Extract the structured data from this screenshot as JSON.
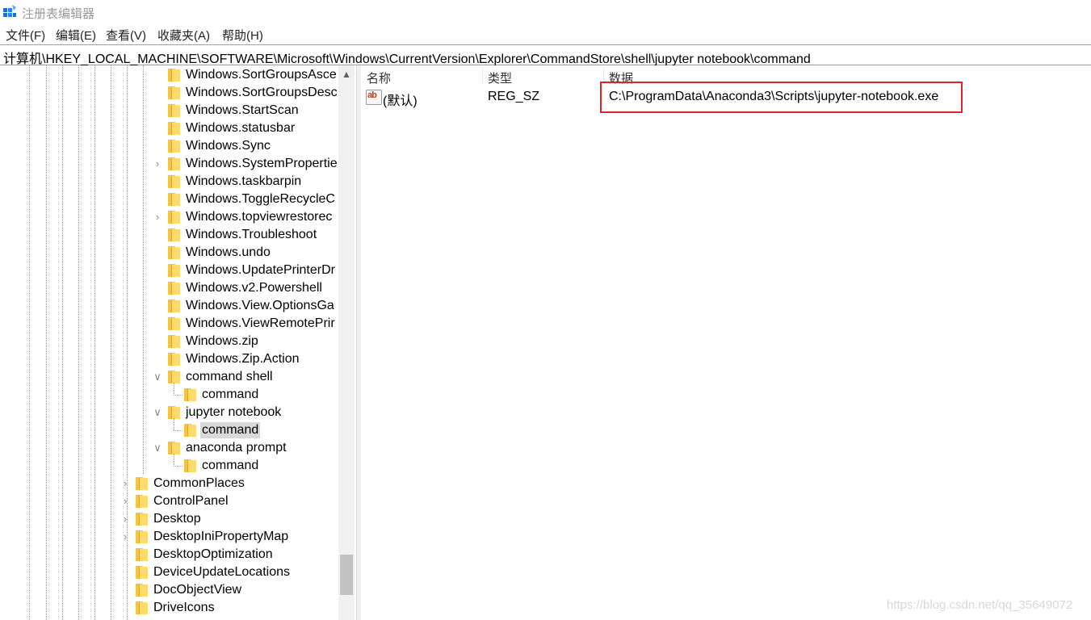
{
  "window": {
    "title": "注册表编辑器"
  },
  "menu": [
    {
      "label": "文件(F)"
    },
    {
      "label": "编辑(E)"
    },
    {
      "label": "查看(V)"
    },
    {
      "label": "收藏夹(A)"
    },
    {
      "label": "帮助(H)"
    }
  ],
  "address": "计算机\\HKEY_LOCAL_MACHINE\\SOFTWARE\\Microsoft\\Windows\\CurrentVersion\\Explorer\\CommandStore\\shell\\jupyter notebook\\command",
  "tree": {
    "items": [
      {
        "label": "Windows.SortGroupsAsce",
        "level": 2,
        "expander": "none",
        "selected": false
      },
      {
        "label": "Windows.SortGroupsDesc",
        "level": 2,
        "expander": "none",
        "selected": false
      },
      {
        "label": "Windows.StartScan",
        "level": 2,
        "expander": "none",
        "selected": false
      },
      {
        "label": "Windows.statusbar",
        "level": 2,
        "expander": "none",
        "selected": false
      },
      {
        "label": "Windows.Sync",
        "level": 2,
        "expander": "none",
        "selected": false
      },
      {
        "label": "Windows.SystemPropertie",
        "level": 2,
        "expander": "collapsed",
        "selected": false
      },
      {
        "label": "Windows.taskbarpin",
        "level": 2,
        "expander": "none",
        "selected": false
      },
      {
        "label": "Windows.ToggleRecycleC",
        "level": 2,
        "expander": "none",
        "selected": false
      },
      {
        "label": "Windows.topviewrestorec",
        "level": 2,
        "expander": "collapsed",
        "selected": false
      },
      {
        "label": "Windows.Troubleshoot",
        "level": 2,
        "expander": "none",
        "selected": false
      },
      {
        "label": "Windows.undo",
        "level": 2,
        "expander": "none",
        "selected": false
      },
      {
        "label": "Windows.UpdatePrinterDr",
        "level": 2,
        "expander": "none",
        "selected": false
      },
      {
        "label": "Windows.v2.Powershell",
        "level": 2,
        "expander": "none",
        "selected": false
      },
      {
        "label": "Windows.View.OptionsGa",
        "level": 2,
        "expander": "none",
        "selected": false
      },
      {
        "label": "Windows.ViewRemotePrir",
        "level": 2,
        "expander": "none",
        "selected": false
      },
      {
        "label": "Windows.zip",
        "level": 2,
        "expander": "none",
        "selected": false
      },
      {
        "label": "Windows.Zip.Action",
        "level": 2,
        "expander": "none",
        "selected": false
      },
      {
        "label": "command shell",
        "level": 2,
        "expander": "expanded",
        "selected": false
      },
      {
        "label": "command",
        "level": 3,
        "expander": "none",
        "selected": false
      },
      {
        "label": "jupyter notebook",
        "level": 2,
        "expander": "expanded",
        "selected": false
      },
      {
        "label": "command",
        "level": 3,
        "expander": "none",
        "selected": true
      },
      {
        "label": "anaconda prompt",
        "level": 2,
        "expander": "expanded",
        "selected": false
      },
      {
        "label": "command",
        "level": 3,
        "expander": "none",
        "selected": false
      },
      {
        "label": "CommonPlaces",
        "level": 1,
        "expander": "collapsed",
        "selected": false
      },
      {
        "label": "ControlPanel",
        "level": 1,
        "expander": "collapsed",
        "selected": false
      },
      {
        "label": "Desktop",
        "level": 1,
        "expander": "collapsed",
        "selected": false
      },
      {
        "label": "DesktopIniPropertyMap",
        "level": 1,
        "expander": "collapsed",
        "selected": false
      },
      {
        "label": "DesktopOptimization",
        "level": 1,
        "expander": "none",
        "selected": false
      },
      {
        "label": "DeviceUpdateLocations",
        "level": 1,
        "expander": "none",
        "selected": false
      },
      {
        "label": "DocObjectView",
        "level": 1,
        "expander": "none",
        "selected": false
      },
      {
        "label": "DriveIcons",
        "level": 1,
        "expander": "none",
        "selected": false
      }
    ]
  },
  "values": {
    "columns": {
      "name": "名称",
      "type": "类型",
      "data": "数据"
    },
    "rows": [
      {
        "name": "(默认)",
        "type": "REG_SZ",
        "data": "C:\\ProgramData\\Anaconda3\\Scripts\\jupyter-notebook.exe",
        "icon": "ab-string-icon",
        "icon_text": "ab"
      }
    ]
  },
  "annotation": {
    "highlight_color": "#e0232b"
  },
  "watermark": "https://blog.csdn.net/qq_35649072",
  "colors": {
    "folder": "#f2c44a",
    "selected_bg": "#d9d9d9"
  }
}
